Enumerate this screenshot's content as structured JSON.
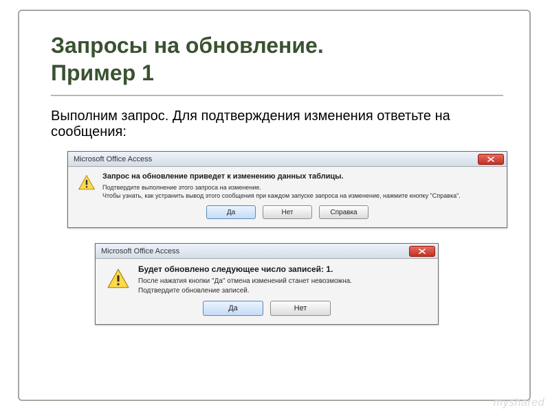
{
  "slide": {
    "title_line1": "Запросы на обновление.",
    "title_line2": "Пример 1",
    "intro": "Выполним запрос. Для подтверждения изменения ответьте на сообщения:"
  },
  "dialog1": {
    "title": "Microsoft Office Access",
    "heading": "Запрос на обновление приведет к изменению данных таблицы.",
    "line1": "Подтвердите выполнение этого запроса на изменение.",
    "line2": "Чтобы узнать, как устранить вывод этого сообщения при каждом запуске запроса на изменение, нажмите кнопку \"Справка\".",
    "btn_yes": "Да",
    "btn_no": "Нет",
    "btn_help": "Справка"
  },
  "dialog2": {
    "title": "Microsoft Office Access",
    "heading": "Будет обновлено следующее число записей: 1.",
    "line1": "После нажатия кнопки \"Да\" отмена изменений станет невозможна.",
    "line2": "Подтвердите обновление записей.",
    "btn_yes": "Да",
    "btn_no": "Нет"
  },
  "watermark": "myshared"
}
